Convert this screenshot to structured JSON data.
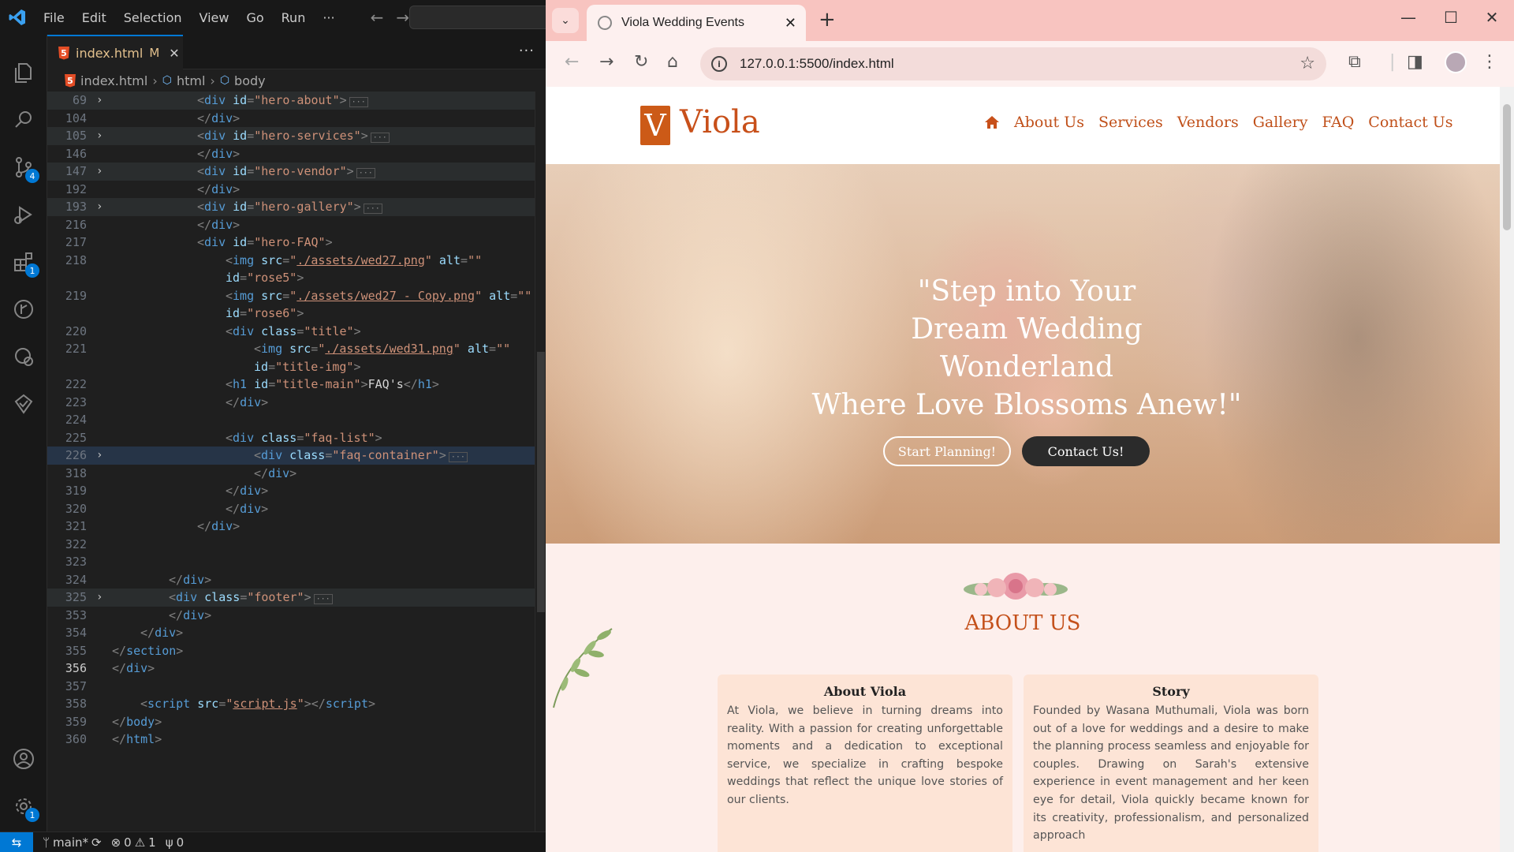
{
  "vscode": {
    "menu": [
      "File",
      "Edit",
      "Selection",
      "View",
      "Go",
      "Run",
      "···"
    ],
    "tab": {
      "name": "index.html",
      "modified": "M",
      "close": "✕"
    },
    "breadcrumb": [
      "index.html",
      "html",
      "body"
    ],
    "activity_badges": {
      "source_control": "4",
      "extensions": "1",
      "settings": "1"
    },
    "status": {
      "branch": "main*",
      "errors": "0",
      "warnings": "1",
      "ports": "0"
    }
  },
  "code_lines": [
    {
      "n": "69",
      "fold": true,
      "hl": "bg",
      "indent": 3,
      "parts": [
        [
          "tg",
          "<"
        ],
        [
          "tn",
          "div"
        ],
        [
          "an",
          " id"
        ],
        [
          "tg",
          "="
        ],
        [
          "av",
          "\"hero-about\""
        ],
        [
          "tg",
          ">"
        ]
      ],
      "ellipsis": true
    },
    {
      "n": "104",
      "indent": 3,
      "parts": [
        [
          "tg",
          "</"
        ],
        [
          "tn",
          "div"
        ],
        [
          "tg",
          ">"
        ]
      ]
    },
    {
      "n": "105",
      "fold": true,
      "hl": "bg",
      "indent": 3,
      "parts": [
        [
          "tg",
          "<"
        ],
        [
          "tn",
          "div"
        ],
        [
          "an",
          " id"
        ],
        [
          "tg",
          "="
        ],
        [
          "av",
          "\"hero-services\""
        ],
        [
          "tg",
          ">"
        ]
      ],
      "ellipsis": true
    },
    {
      "n": "146",
      "indent": 3,
      "parts": [
        [
          "tg",
          "</"
        ],
        [
          "tn",
          "div"
        ],
        [
          "tg",
          ">"
        ]
      ]
    },
    {
      "n": "147",
      "fold": true,
      "hl": "bg",
      "indent": 3,
      "parts": [
        [
          "tg",
          "<"
        ],
        [
          "tn",
          "div"
        ],
        [
          "an",
          " id"
        ],
        [
          "tg",
          "="
        ],
        [
          "av",
          "\"hero-vendor\""
        ],
        [
          "tg",
          ">"
        ]
      ],
      "ellipsis": true
    },
    {
      "n": "192",
      "indent": 3,
      "parts": [
        [
          "tg",
          "</"
        ],
        [
          "tn",
          "div"
        ],
        [
          "tg",
          ">"
        ]
      ]
    },
    {
      "n": "193",
      "fold": true,
      "hl": "bg",
      "indent": 3,
      "parts": [
        [
          "tg",
          "<"
        ],
        [
          "tn",
          "div"
        ],
        [
          "an",
          " id"
        ],
        [
          "tg",
          "="
        ],
        [
          "av",
          "\"hero-gallery\""
        ],
        [
          "tg",
          ">"
        ]
      ],
      "ellipsis": true
    },
    {
      "n": "216",
      "indent": 3,
      "parts": [
        [
          "tg",
          "</"
        ],
        [
          "tn",
          "div"
        ],
        [
          "tg",
          ">"
        ]
      ]
    },
    {
      "n": "217",
      "indent": 3,
      "parts": [
        [
          "tg",
          "<"
        ],
        [
          "tn",
          "div"
        ],
        [
          "an",
          " id"
        ],
        [
          "tg",
          "="
        ],
        [
          "av",
          "\"hero-FAQ\""
        ],
        [
          "tg",
          ">"
        ]
      ]
    },
    {
      "n": "218",
      "indent": 4,
      "parts": [
        [
          "tg",
          "<"
        ],
        [
          "tn",
          "img"
        ],
        [
          "an",
          " src"
        ],
        [
          "tg",
          "="
        ],
        [
          "av",
          "\""
        ],
        [
          "avu",
          "./assets/wed27.png"
        ],
        [
          "av",
          "\""
        ],
        [
          "an",
          " alt"
        ],
        [
          "tg",
          "="
        ],
        [
          "av",
          "\"\""
        ]
      ]
    },
    {
      "n": "",
      "indent": 4,
      "parts": [
        [
          "an",
          "id"
        ],
        [
          "tg",
          "="
        ],
        [
          "av",
          "\"rose5\""
        ],
        [
          "tg",
          ">"
        ]
      ]
    },
    {
      "n": "219",
      "indent": 4,
      "parts": [
        [
          "tg",
          "<"
        ],
        [
          "tn",
          "img"
        ],
        [
          "an",
          " src"
        ],
        [
          "tg",
          "="
        ],
        [
          "av",
          "\""
        ],
        [
          "avu",
          "./assets/wed27 - Copy.png"
        ],
        [
          "av",
          "\""
        ],
        [
          "an",
          " alt"
        ],
        [
          "tg",
          "="
        ],
        [
          "av",
          "\"\""
        ]
      ]
    },
    {
      "n": "",
      "indent": 4,
      "parts": [
        [
          "an",
          "id"
        ],
        [
          "tg",
          "="
        ],
        [
          "av",
          "\"rose6\""
        ],
        [
          "tg",
          ">"
        ]
      ]
    },
    {
      "n": "220",
      "indent": 4,
      "parts": [
        [
          "tg",
          "<"
        ],
        [
          "tn",
          "div"
        ],
        [
          "an",
          " class"
        ],
        [
          "tg",
          "="
        ],
        [
          "av",
          "\"title\""
        ],
        [
          "tg",
          ">"
        ]
      ]
    },
    {
      "n": "221",
      "indent": 5,
      "parts": [
        [
          "tg",
          "<"
        ],
        [
          "tn",
          "img"
        ],
        [
          "an",
          " src"
        ],
        [
          "tg",
          "="
        ],
        [
          "av",
          "\""
        ],
        [
          "avu",
          "./assets/wed31.png"
        ],
        [
          "av",
          "\""
        ],
        [
          "an",
          " alt"
        ],
        [
          "tg",
          "="
        ],
        [
          "av",
          "\"\""
        ]
      ]
    },
    {
      "n": "",
      "indent": 5,
      "parts": [
        [
          "an",
          "id"
        ],
        [
          "tg",
          "="
        ],
        [
          "av",
          "\"title-img\""
        ],
        [
          "tg",
          ">"
        ]
      ]
    },
    {
      "n": "222",
      "indent": 4,
      "parts": [
        [
          "tg",
          "<"
        ],
        [
          "tn",
          "h1"
        ],
        [
          "an",
          " id"
        ],
        [
          "tg",
          "="
        ],
        [
          "av",
          "\"title-main\""
        ],
        [
          "tg",
          ">"
        ],
        [
          "tx",
          "FAQ's"
        ],
        [
          "tg",
          "</"
        ],
        [
          "tn",
          "h1"
        ],
        [
          "tg",
          ">"
        ]
      ]
    },
    {
      "n": "223",
      "indent": 4,
      "parts": [
        [
          "tg",
          "</"
        ],
        [
          "tn",
          "div"
        ],
        [
          "tg",
          ">"
        ]
      ]
    },
    {
      "n": "224",
      "indent": 0,
      "parts": []
    },
    {
      "n": "225",
      "indent": 4,
      "parts": [
        [
          "tg",
          "<"
        ],
        [
          "tn",
          "div"
        ],
        [
          "an",
          " class"
        ],
        [
          "tg",
          "="
        ],
        [
          "av",
          "\"faq-list\""
        ],
        [
          "tg",
          ">"
        ]
      ]
    },
    {
      "n": "226",
      "fold": true,
      "hl": "hl",
      "indent": 5,
      "parts": [
        [
          "tg",
          "<"
        ],
        [
          "tn",
          "div"
        ],
        [
          "an",
          " class"
        ],
        [
          "tg",
          "="
        ],
        [
          "av",
          "\"faq-container\""
        ],
        [
          "tg",
          ">"
        ]
      ],
      "ellipsis": true
    },
    {
      "n": "318",
      "indent": 5,
      "parts": [
        [
          "tg",
          "</"
        ],
        [
          "tn",
          "div"
        ],
        [
          "tg",
          ">"
        ]
      ]
    },
    {
      "n": "319",
      "indent": 4,
      "parts": [
        [
          "tg",
          "</"
        ],
        [
          "tn",
          "div"
        ],
        [
          "tg",
          ">"
        ]
      ]
    },
    {
      "n": "320",
      "indent": 4,
      "parts": [
        [
          "tg",
          "</"
        ],
        [
          "tn",
          "div"
        ],
        [
          "tg",
          ">"
        ]
      ]
    },
    {
      "n": "321",
      "indent": 3,
      "parts": [
        [
          "tg",
          "</"
        ],
        [
          "tn",
          "div"
        ],
        [
          "tg",
          ">"
        ]
      ]
    },
    {
      "n": "322",
      "indent": 0,
      "parts": []
    },
    {
      "n": "323",
      "indent": 0,
      "parts": []
    },
    {
      "n": "324",
      "indent": 2,
      "parts": [
        [
          "tg",
          "</"
        ],
        [
          "tn",
          "div"
        ],
        [
          "tg",
          ">"
        ]
      ]
    },
    {
      "n": "325",
      "fold": true,
      "hl": "bg",
      "indent": 2,
      "parts": [
        [
          "tg",
          "<"
        ],
        [
          "tn",
          "div"
        ],
        [
          "an",
          " class"
        ],
        [
          "tg",
          "="
        ],
        [
          "av",
          "\"footer\""
        ],
        [
          "tg",
          ">"
        ]
      ],
      "ellipsis": true
    },
    {
      "n": "353",
      "indent": 2,
      "parts": [
        [
          "tg",
          "</"
        ],
        [
          "tn",
          "div"
        ],
        [
          "tg",
          ">"
        ]
      ]
    },
    {
      "n": "354",
      "indent": 1,
      "parts": [
        [
          "tg",
          "</"
        ],
        [
          "tn",
          "div"
        ],
        [
          "tg",
          ">"
        ]
      ]
    },
    {
      "n": "355",
      "indent": 0,
      "parts": [
        [
          "tg",
          "</"
        ],
        [
          "tn",
          "section"
        ],
        [
          "tg",
          ">"
        ]
      ]
    },
    {
      "n": "356",
      "cur": true,
      "indent": 0,
      "parts": [
        [
          "tg",
          "</"
        ],
        [
          "tn",
          "div"
        ],
        [
          "tg",
          ">"
        ]
      ]
    },
    {
      "n": "357",
      "indent": 0,
      "parts": []
    },
    {
      "n": "358",
      "indent": 1,
      "parts": [
        [
          "tg",
          "<"
        ],
        [
          "tn",
          "script"
        ],
        [
          "an",
          " src"
        ],
        [
          "tg",
          "="
        ],
        [
          "av",
          "\""
        ],
        [
          "avu",
          "script.js"
        ],
        [
          "av",
          "\""
        ],
        [
          "tg",
          "></"
        ],
        [
          "tn",
          "script"
        ],
        [
          "tg",
          ">"
        ]
      ]
    },
    {
      "n": "359",
      "indent": 0,
      "parts": [
        [
          "tg",
          "</"
        ],
        [
          "tn",
          "body"
        ],
        [
          "tg",
          ">"
        ]
      ]
    },
    {
      "n": "360",
      "indent": 0,
      "parts": [
        [
          "tg",
          "</"
        ],
        [
          "tn",
          "html"
        ],
        [
          "tg",
          ">"
        ]
      ]
    }
  ],
  "browser": {
    "tab_title": "Viola Wedding Events",
    "url": "127.0.0.1:5500/index.html"
  },
  "site": {
    "logo_letter": "V",
    "logo_text": "Viola",
    "nav": [
      "About Us",
      "Services",
      "Vendors",
      "Gallery",
      "FAQ",
      "Contact Us"
    ],
    "hero_title_lines": [
      "\"Step into Your",
      "Dream Wedding",
      "Wonderland",
      "Where Love Blossoms Anew!\""
    ],
    "btn_start": "Start Planning!",
    "btn_contact": "Contact Us!",
    "about_title": "ABOUT US",
    "card1": {
      "title": "About Viola",
      "text": "At Viola, we believe in turning dreams into reality. With a passion for creating unforgettable moments and a dedication to exceptional service, we specialize in crafting bespoke weddings that reflect the unique love stories of our clients."
    },
    "card2": {
      "title": "Story",
      "text": "Founded by Wasana Muthumali, Viola was born out of a love for weddings and a desire to make the planning process seamless and enjoyable for couples. Drawing on Sarah's extensive experience in event management and her keen eye for detail, Viola quickly became known for its creativity, professionalism, and personalized approach"
    }
  },
  "colors": {
    "brand": "#c8501a",
    "vscode_accent": "#0078d4",
    "browser_frame": "#f8c4c0"
  }
}
